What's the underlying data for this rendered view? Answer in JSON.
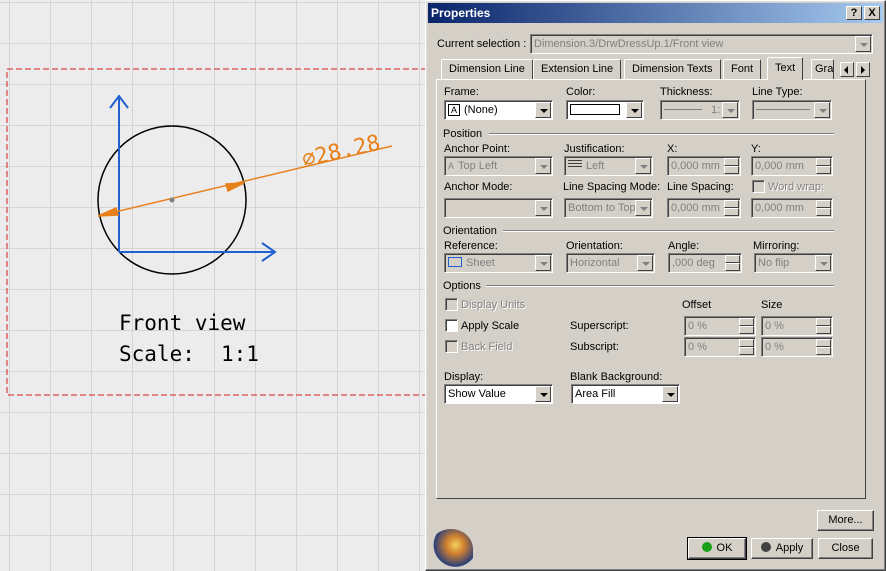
{
  "drawing": {
    "dimension_text": "⌀28.28",
    "view_title": "Front view",
    "scale_label": "Scale:",
    "scale_value": "1:1",
    "colors": {
      "frame": "#d62020",
      "axis": "#2060d0",
      "dimension": "#e8801a"
    }
  },
  "dialog": {
    "title": "Properties",
    "help_button": "?",
    "close_button": "X",
    "current_selection_label": "Current selection :",
    "current_selection_value": "Dimension.3/DrwDressUp.1/Front view",
    "tabs": [
      "Dimension Line",
      "Extension Line",
      "Dimension Texts",
      "Font",
      "Text",
      "Gra"
    ],
    "active_tab": "Text",
    "frame_label": "Frame:",
    "frame_value": "(None)",
    "color_label": "Color:",
    "thickness_label": "Thickness:",
    "thickness_value": "1:",
    "line_type_label": "Line Type:",
    "position_group": "Position",
    "anchor_point_label": "Anchor Point:",
    "anchor_point_value": "Top Left",
    "justification_label": "Justification:",
    "justification_value": "Left",
    "x_label": "X:",
    "x_value": "0,000 mm",
    "y_label": "Y:",
    "y_value": "0,000 mm",
    "anchor_mode_label": "Anchor Mode:",
    "line_spacing_mode_label": "Line Spacing Mode:",
    "line_spacing_mode_value": "Bottom to Top",
    "line_spacing_label": "Line Spacing:",
    "line_spacing_value": "0,000 mm",
    "word_wrap_label": "Word wrap:",
    "word_wrap_value": "0,000 mm",
    "orientation_group": "Orientation",
    "reference_label": "Reference:",
    "reference_value": "Sheet",
    "orientation_label": "Orientation:",
    "orientation_value": "Horizontal",
    "angle_label": "Angle:",
    "angle_value": ",000 deg",
    "mirroring_label": "Mirroring:",
    "mirroring_value": "No flip",
    "options_group": "Options",
    "offset_header": "Offset",
    "size_header": "Size",
    "display_units_label": "Display Units",
    "apply_scale_label": "Apply Scale",
    "back_field_label": "Back Field",
    "superscript_label": "Superscript:",
    "superscript_offset": "0 %",
    "superscript_size": "0 %",
    "subscript_label": "Subscript:",
    "subscript_offset": "0 %",
    "subscript_size": "0 %",
    "display_label": "Display:",
    "display_value": "Show Value",
    "blank_background_label": "Blank Background:",
    "blank_background_value": "Area Fill",
    "more_button": "More...",
    "ok_button": "OK",
    "apply_button": "Apply",
    "close_btn": "Close",
    "colors": {
      "ok_dot": "#18a018",
      "apply_dot": "#404040",
      "title_start": "#0a246a",
      "title_end": "#a6caf0"
    }
  }
}
